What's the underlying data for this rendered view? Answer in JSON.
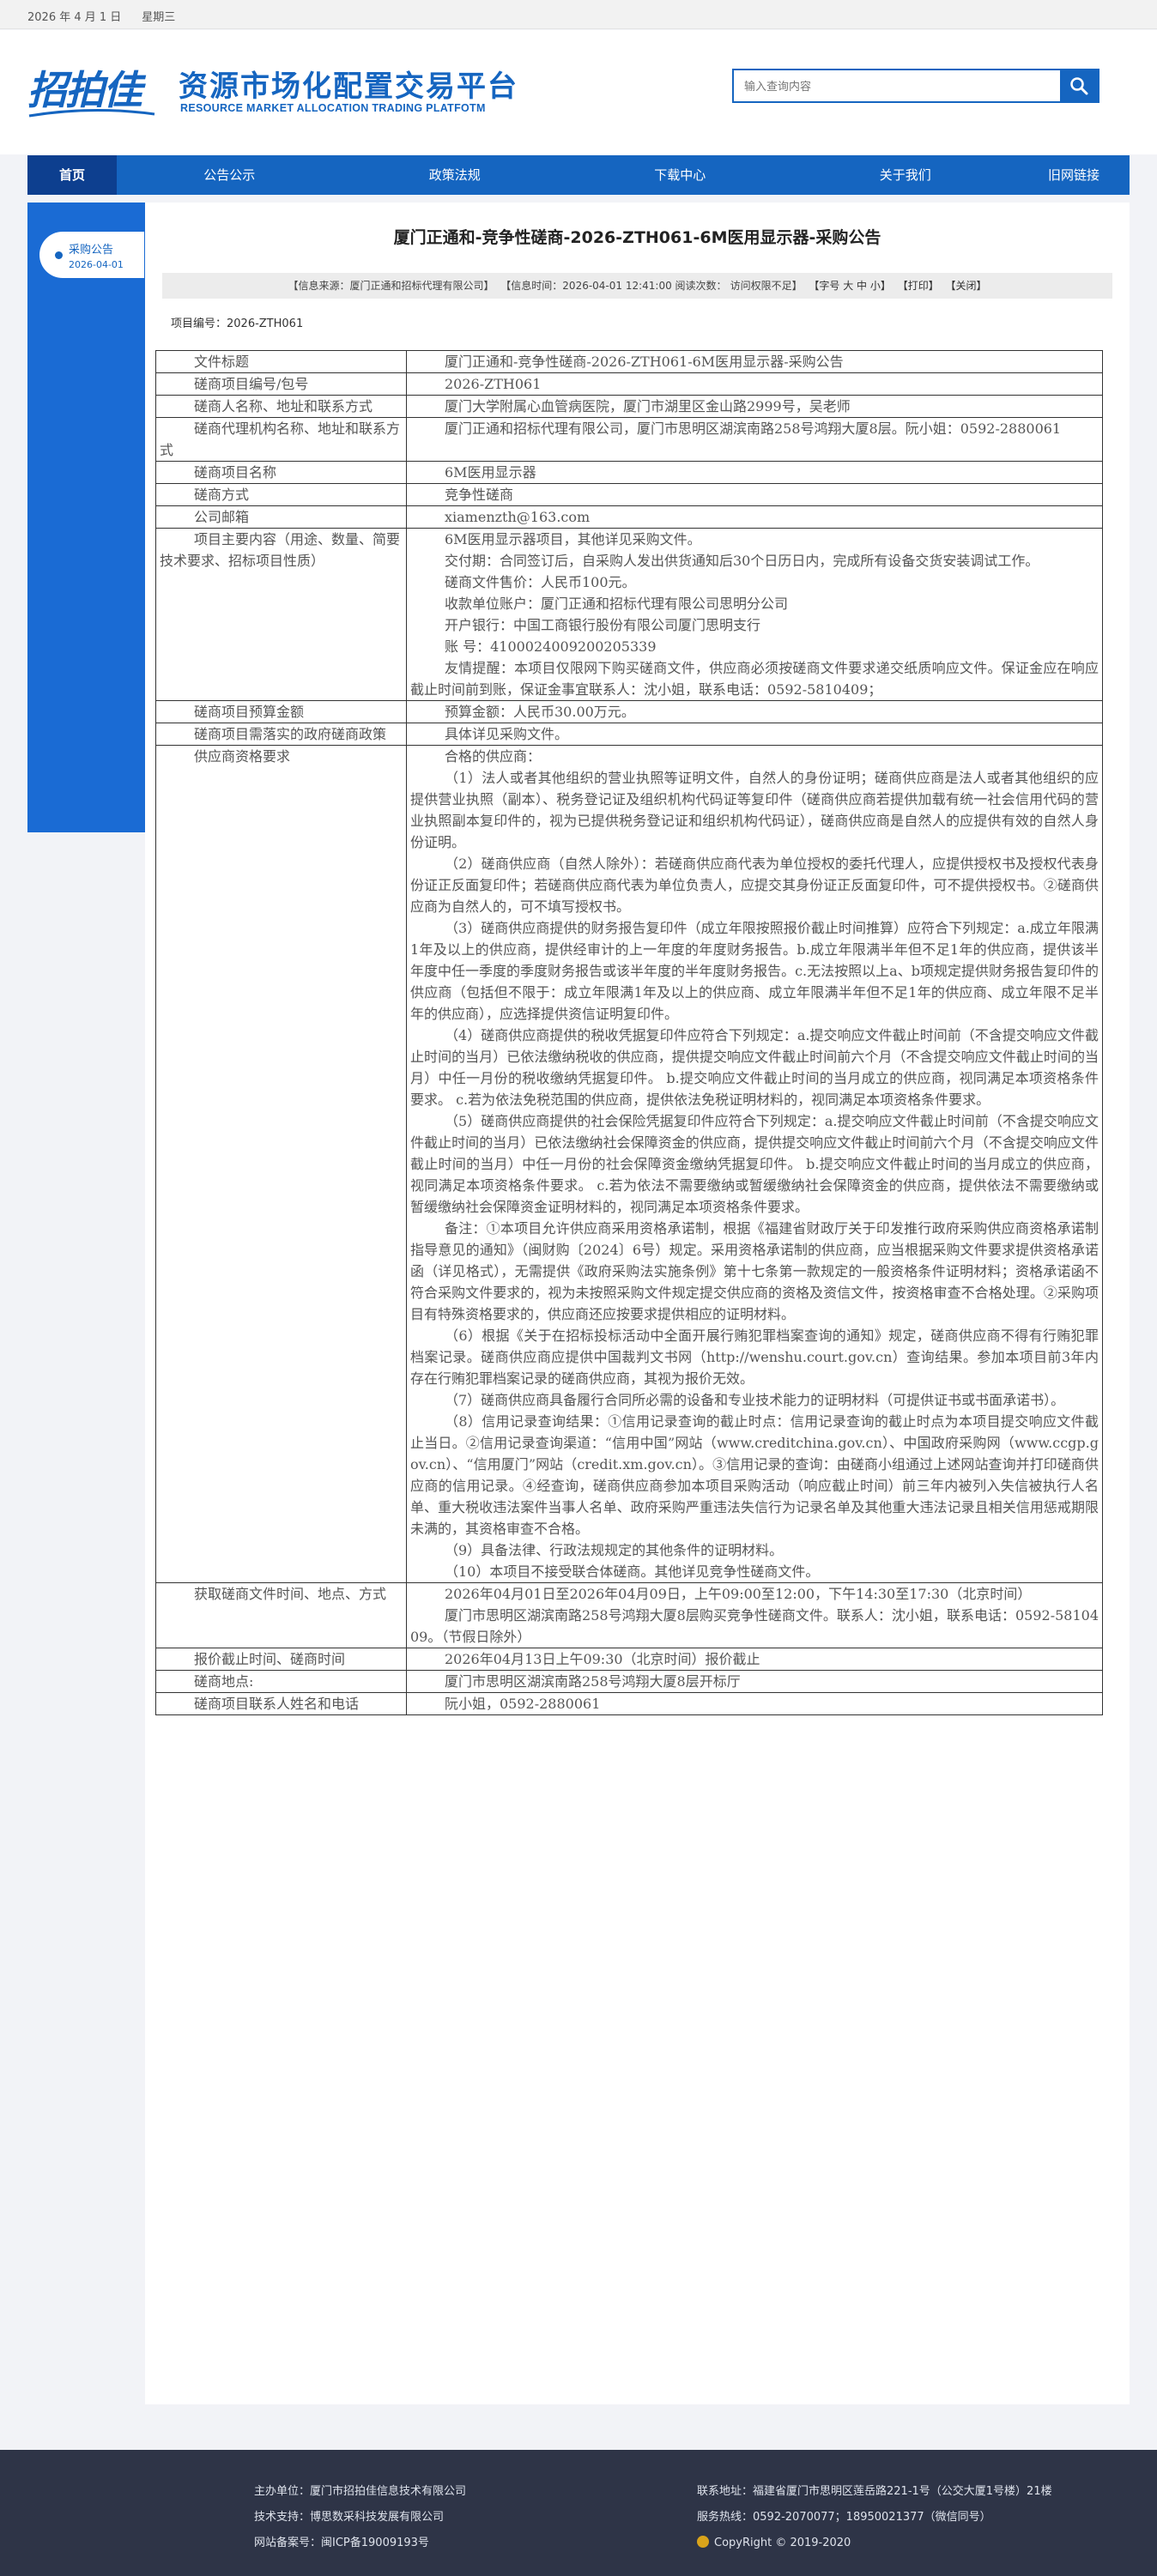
{
  "topbar": {
    "date": "2026 年 4 月 1 日",
    "weekday": "星期三"
  },
  "header": {
    "logo_text": "招拍佳",
    "title_cn": "资源市场化配置交易平台",
    "title_en": "RESOURCE MARKET ALLOCATION TRADING PLATFOTM",
    "search_placeholder": "输入查询内容"
  },
  "nav": [
    "首页",
    "公告公示",
    "政策法规",
    "下载中心",
    "关于我们",
    "旧网链接"
  ],
  "sidebar": {
    "label": "采购公告",
    "date": "2026-04-01"
  },
  "article": {
    "title": "厦门正通和-竞争性磋商-2026-ZTH061-6M医用显示器-采购公告",
    "info": {
      "source": "【信息来源：厦门正通和招标代理有限公司】",
      "time": "【信息时间：2026-04-01 12:41:00 阅读次数：",
      "access": "访问权限不足】",
      "fontsize": "【字号 大 中 小】",
      "print": "【打印】",
      "close": "【关闭】"
    },
    "project_no": "项目编号：2026-ZTH061"
  },
  "table": {
    "title_k": "文件标题",
    "title_v": "厦门正通和-竞争性磋商-2026-ZTH061-6M医用显示器-采购公告",
    "no_k": "磋商项目编号/包号",
    "no_v": "2026-ZTH061",
    "buyer_k": "磋商人名称、地址和联系方式",
    "buyer_v": "厦门大学附属心血管病医院，厦门市湖里区金山路2999号，吴老师",
    "agent_k": "磋商代理机构名称、地址和联系方式",
    "agent_v": "厦门正通和招标代理有限公司，厦门市思明区湖滨南路258号鸿翔大厦8层。阮小姐：0592-2880061",
    "name_k": "磋商项目名称",
    "name_v": "6M医用显示器",
    "method_k": "磋商方式",
    "method_v": "竞争性磋商",
    "email_k": "公司邮箱",
    "email_v": "xiamenzth@163.com",
    "content_k": "项目主要内容（用途、数量、简要技术要求、招标项目性质）",
    "content_v": [
      "6M医用显示器项目，其他详见采购文件。",
      "交付期：合同签订后，自采购人发出供货通知后30个日历日内，完成所有设备交货安装调试工作。",
      "磋商文件售价：人民币100元。",
      "收款单位账户：厦门正通和招标代理有限公司思明分公司",
      "开户银行：中国工商银行股份有限公司厦门思明支行",
      "账  号：4100024009200205339",
      "友情提醒：本项目仅限网下购买磋商文件，供应商必须按磋商文件要求递交纸质响应文件。保证金应在响应截止时间前到账，保证金事宜联系人：沈小姐，联系电话：0592-5810409；"
    ],
    "budget_k": "磋商项目预算金额",
    "budget_v": "预算金额：人民币30.00万元。",
    "policy_k": "磋商项目需落实的政府磋商政策",
    "policy_v": "具体详见采购文件。",
    "qual_k": "供应商资格要求",
    "qual_v": [
      "合格的供应商：",
      "（1）法人或者其他组织的营业执照等证明文件，自然人的身份证明；磋商供应商是法人或者其他组织的应提供营业执照（副本）、税务登记证及组织机构代码证等复印件（磋商供应商若提供加载有统一社会信用代码的营业执照副本复印件的，视为已提供税务登记证和组织机构代码证），磋商供应商是自然人的应提供有效的自然人身份证明。",
      "（2）磋商供应商（自然人除外）：若磋商供应商代表为单位授权的委托代理人，应提供授权书及授权代表身份证正反面复印件；若磋商供应商代表为单位负责人，应提交其身份证正反面复印件，可不提供授权书。②磋商供应商为自然人的，可不填写授权书。",
      "（3）磋商供应商提供的财务报告复印件（成立年限按照报价截止时间推算）应符合下列规定：a.成立年限满1年及以上的供应商，提供经审计的上一年度的年度财务报告。b.成立年限满半年但不足1年的供应商，提供该半年度中任一季度的季度财务报告或该半年度的半年度财务报告。c.无法按照以上a、b项规定提供财务报告复印件的供应商（包括但不限于：成立年限满1年及以上的供应商、成立年限满半年但不足1年的供应商、成立年限不足半年的供应商），应选择提供资信证明复印件。",
      "（4）磋商供应商提供的税收凭据复印件应符合下列规定：a.提交响应文件截止时间前（不含提交响应文件截止时间的当月）已依法缴纳税收的供应商，提供提交响应文件截止时间前六个月（不含提交响应文件截止时间的当月）中任一月份的税收缴纳凭据复印件。 b.提交响应文件截止时间的当月成立的供应商，视同满足本项资格条件要求。 c.若为依法免税范围的供应商，提供依法免税证明材料的，视同满足本项资格条件要求。",
      "（5）磋商供应商提供的社会保险凭据复印件应符合下列规定：a.提交响应文件截止时间前（不含提交响应文件截止时间的当月）已依法缴纳社会保障资金的供应商，提供提交响应文件截止时间前六个月（不含提交响应文件截止时间的当月）中任一月份的社会保障资金缴纳凭据复印件。 b.提交响应文件截止时间的当月成立的供应商，视同满足本项资格条件要求。 c.若为依法不需要缴纳或暂缓缴纳社会保障资金的供应商，提供依法不需要缴纳或暂缓缴纳社会保障资金证明材料的，视同满足本项资格条件要求。",
      "备注：①本项目允许供应商采用资格承诺制，根据《福建省财政厅关于印发推行政府采购供应商资格承诺制指导意见的通知》（闽财购〔2024〕6号）规定。采用资格承诺制的供应商，应当根据采购文件要求提供资格承诺函（详见格式），无需提供《政府采购法实施条例》第十七条第一款规定的一般资格条件证明材料；资格承诺函不符合采购文件要求的，视为未按照采购文件规定提交供应商的资格及资信文件，按资格审查不合格处理。②采购项目有特殊资格要求的，供应商还应按要求提供相应的证明材料。",
      "（6）根据《关于在招标投标活动中全面开展行贿犯罪档案查询的通知》规定，磋商供应商不得有行贿犯罪档案记录。磋商供应商应提供中国裁判文书网（http://wenshu.court.gov.cn）查询结果。参加本项目前3年内存在行贿犯罪档案记录的磋商供应商，其视为报价无效。",
      "（7）磋商供应商具备履行合同所必需的设备和专业技术能力的证明材料（可提供证书或书面承诺书）。",
      "（8）信用记录查询结果：①信用记录查询的截止时点：信用记录查询的截止时点为本项目提交响应文件截止当日。②信用记录查询渠道：“信用中国”网站（www.creditchina.gov.cn）、中国政府采购网（www.ccgp.gov.cn）、“信用厦门”网站（credit.xm.gov.cn）。③信用记录的查询：由磋商小组通过上述网站查询并打印磋商供应商的信用记录。④经查询，磋商供应商参加本项目采购活动（响应截止时间）前三年内被列入失信被执行人名单、重大税收违法案件当事人名单、政府采购严重违法失信行为记录名单及其他重大违法记录且相关信用惩戒期限未满的，其资格审查不合格。",
      "（9）具备法律、行政法规规定的其他条件的证明材料。",
      "（10）本项目不接受联合体磋商。其他详见竞争性磋商文件。"
    ],
    "obtain_k": "获取磋商文件时间、地点、方式",
    "obtain_v": [
      "2026年04月01日至2026年04月09日，上午09:00至12:00，下午14:30至17:30（北京时间）",
      "厦门市思明区湖滨南路258号鸿翔大厦8层购买竞争性磋商文件。联系人：沈小姐，联系电话：0592-5810409。（节假日除外）"
    ],
    "deadline_k": "报价截止时间、磋商时间",
    "deadline_v": "2026年04月13日上午09:30（北京时间）报价截止",
    "place_k": "磋商地点:",
    "place_v": "厦门市思明区湖滨南路258号鸿翔大厦8层开标厅",
    "contact_k": "磋商项目联系人姓名和电话",
    "contact_v": "阮小姐，0592-2880061"
  },
  "footer": {
    "host": "主办单位：厦门市招拍佳信息技术有限公司",
    "support": "技术支持：博思数采科技发展有限公司",
    "icp": "网站备案号：闽ICP备19009193号",
    "address": "联系地址：福建省厦门市思明区莲岳路221-1号（公交大厦1号楼）21楼",
    "phone": "服务热线：0592-2070077；18950021377（微信同号）",
    "copyright": "CopyRight © 2019-2020"
  }
}
